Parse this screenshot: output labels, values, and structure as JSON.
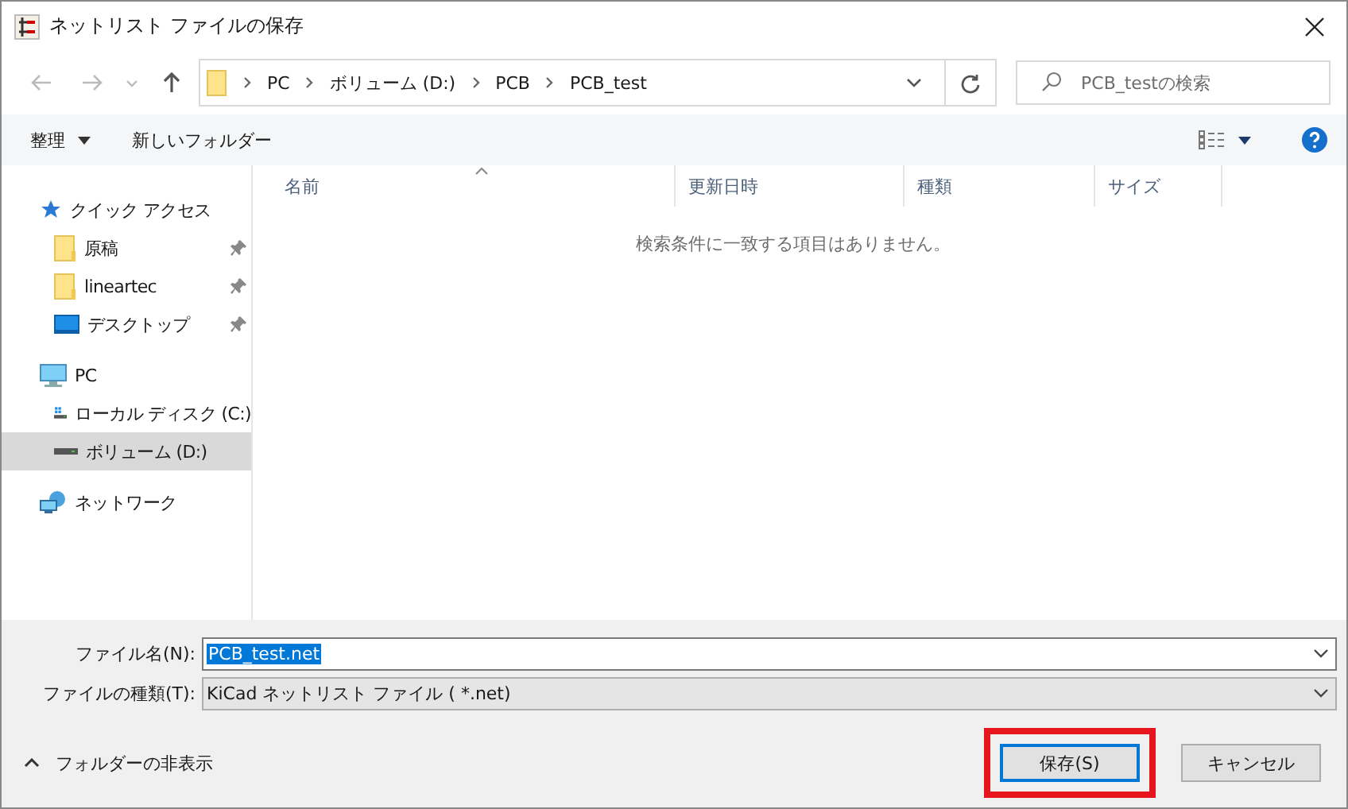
{
  "window": {
    "title": "ネットリスト ファイルの保存"
  },
  "address_bar": {
    "path": [
      "PC",
      "ボリューム (D:)",
      "PCB",
      "PCB_test"
    ]
  },
  "search": {
    "placeholder": "PCB_testの検索"
  },
  "toolbar": {
    "organize": "整理",
    "new_folder": "新しいフォルダー"
  },
  "sidebar": {
    "items": [
      {
        "label": "クイック アクセス",
        "kind": "star",
        "selected": false,
        "children": [
          {
            "label": "原稿",
            "kind": "folder",
            "pinned": true,
            "selected": false
          },
          {
            "label": "lineartec",
            "kind": "folder",
            "pinned": true,
            "selected": false
          },
          {
            "label": "デスクトップ",
            "kind": "desktop",
            "pinned": true,
            "selected": false
          }
        ]
      },
      {
        "label": "PC",
        "kind": "pc",
        "selected": false,
        "children": [
          {
            "label": "ローカル ディスク (C:)",
            "kind": "drive-c",
            "pinned": false,
            "selected": false
          },
          {
            "label": "ボリューム (D:)",
            "kind": "drive",
            "pinned": false,
            "selected": true
          }
        ]
      },
      {
        "label": "ネットワーク",
        "kind": "network",
        "selected": false
      }
    ]
  },
  "file_list": {
    "columns": [
      {
        "label": "名前",
        "sorted": true
      },
      {
        "label": "更新日時",
        "sorted": false
      },
      {
        "label": "種類",
        "sorted": false
      },
      {
        "label": "サイズ",
        "sorted": false
      }
    ],
    "empty_message": "検索条件に一致する項目はありません。"
  },
  "form": {
    "filename_label": "ファイル名(N):",
    "filename_value": "PCB_test.net",
    "filetype_label": "ファイルの種類(T):",
    "filetype_value": "KiCad ネットリスト ファイル ( *.net)"
  },
  "hide_folders": "フォルダーの非表示",
  "buttons": [
    {
      "label": "保存(S)",
      "kind": "primary",
      "highlighted": true
    },
    {
      "label": "キャンセル",
      "kind": "normal",
      "highlighted": false
    }
  ]
}
